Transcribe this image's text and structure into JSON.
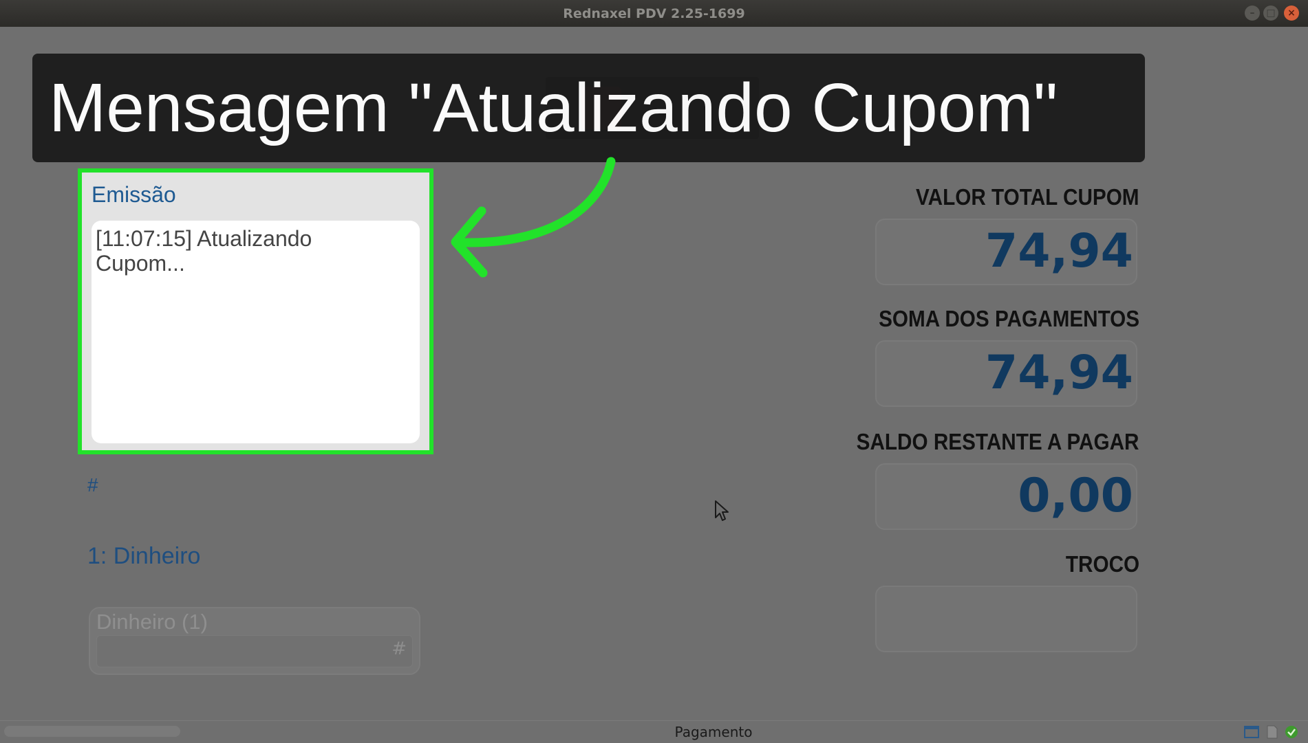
{
  "window": {
    "title": "Rednaxel PDV 2.25-1699"
  },
  "caption": {
    "text": "Mensagem \"Atualizando Cupom\""
  },
  "emission": {
    "label": "Emissão",
    "log_line1": "[11:07:15] Atualizando",
    "log_line2": "Cupom..."
  },
  "payments": {
    "hash": "#",
    "item": "1: Dinheiro",
    "cash_label": "Dinheiro (1)",
    "cash_field_hash": "#"
  },
  "totals": {
    "total_label": "VALOR TOTAL CUPOM",
    "total_value": "74,94",
    "sum_label": "SOMA DOS PAGAMENTOS",
    "sum_value": "74,94",
    "remaining_label": "SALDO RESTANTE A PAGAR",
    "remaining_value": "0,00",
    "change_label": "TROCO",
    "change_value": ""
  },
  "status": {
    "text": "Pagamento"
  },
  "colors": {
    "highlight": "#22e22a",
    "value_blue": "#10395f",
    "label_blue": "#1e5a92"
  }
}
